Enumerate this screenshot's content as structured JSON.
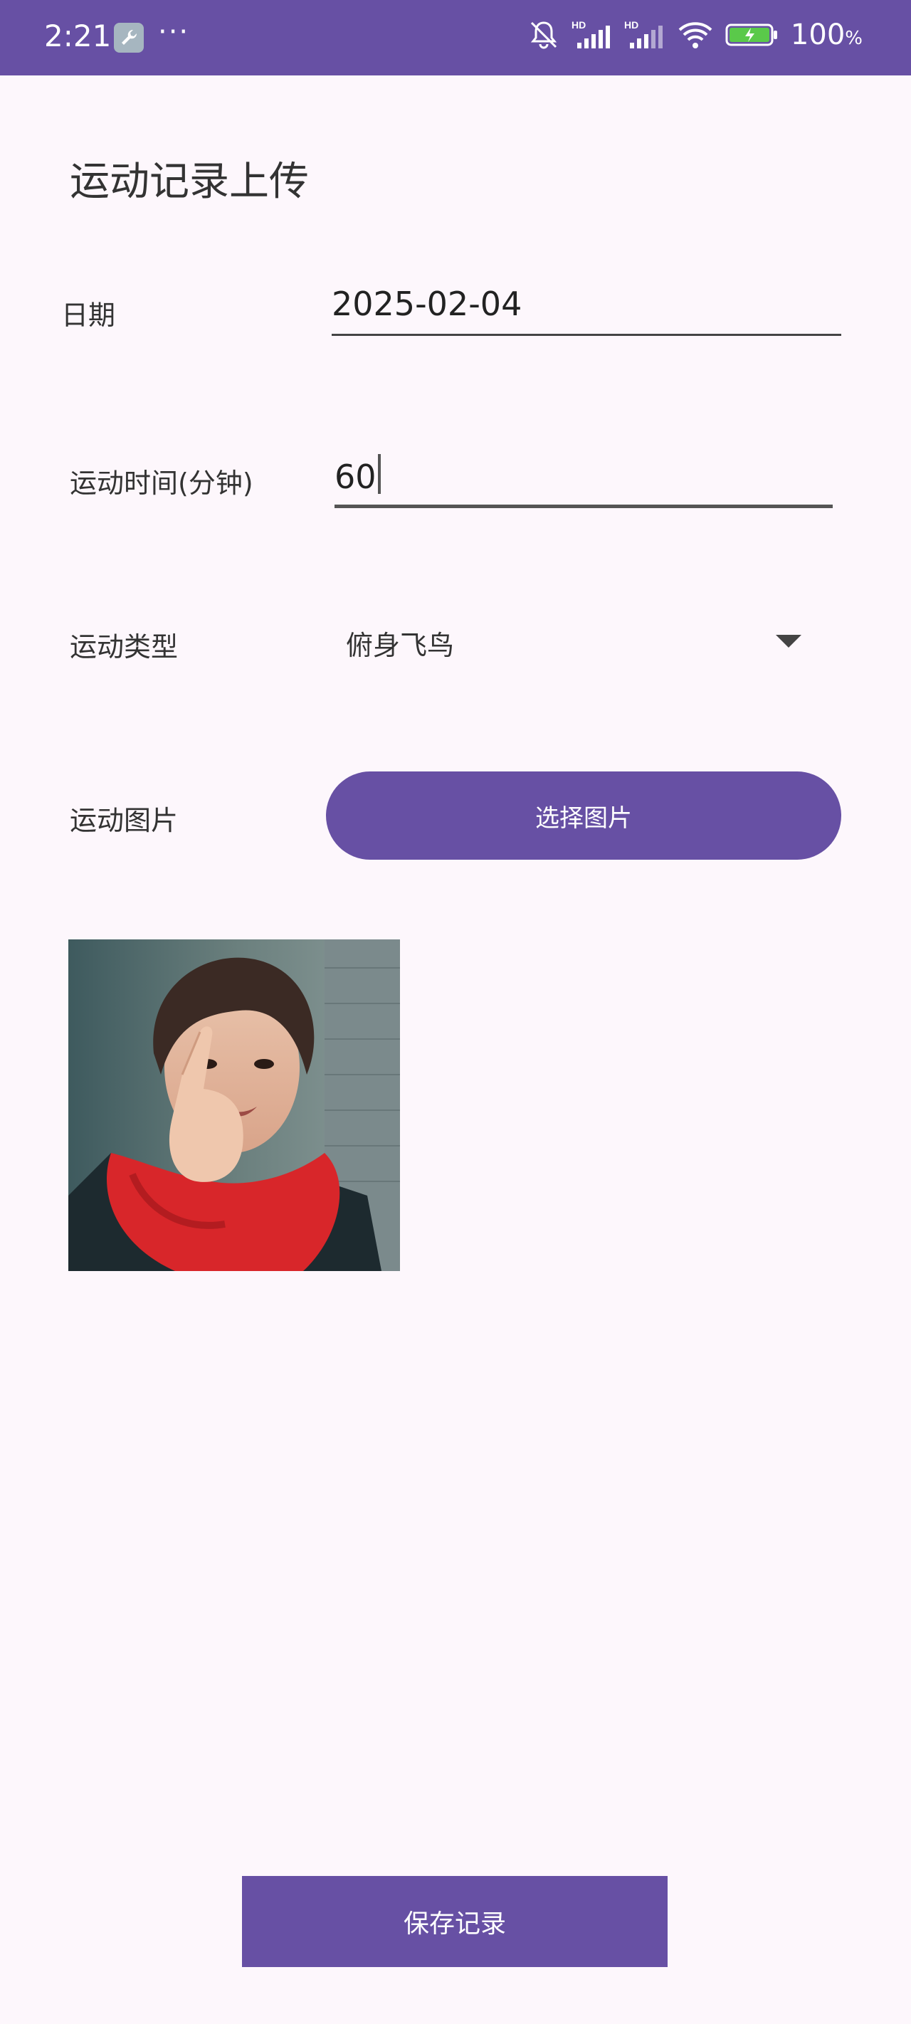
{
  "status_bar": {
    "time": "2:21",
    "more": "···",
    "battery_value": "100",
    "battery_unit": "%",
    "signal_badge_1": "HD",
    "signal_badge_2": "HD",
    "background": "#6750a4"
  },
  "page": {
    "title": "运动记录上传"
  },
  "form": {
    "date_label": "日期",
    "date_value": "2025-02-04",
    "duration_label": "运动时间(分钟)",
    "duration_value": "60",
    "type_label": "运动类型",
    "type_value": "俯身飞鸟",
    "image_label": "运动图片",
    "pick_image_label": "选择图片",
    "selected_image": "person-photo"
  },
  "actions": {
    "save_label": "保存记录"
  },
  "colors": {
    "accent": "#6750a4",
    "background": "#fdf7fc"
  }
}
